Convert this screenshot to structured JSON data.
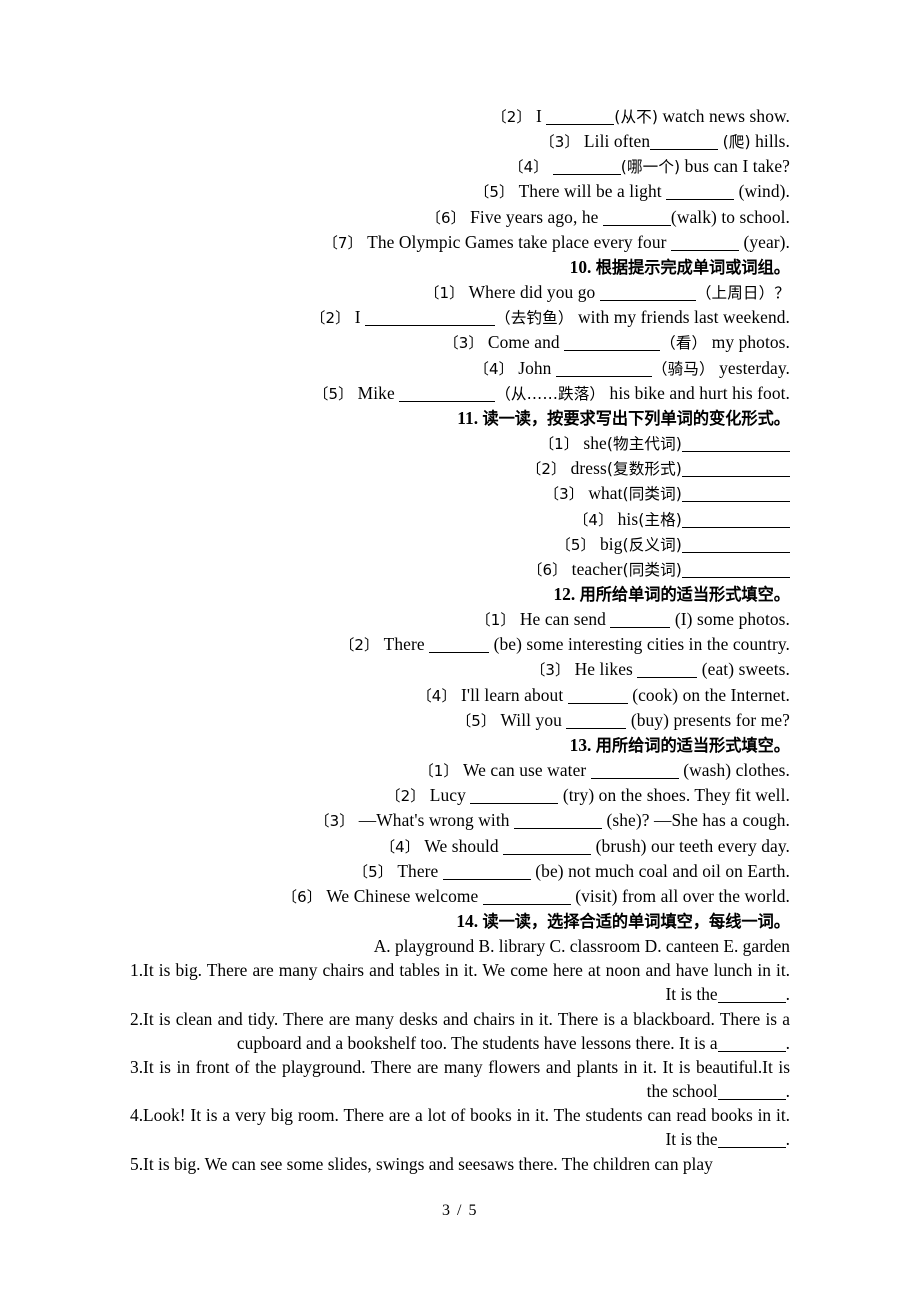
{
  "page": {
    "footer": "3 / 5"
  },
  "section9_tail": {
    "items": [
      {
        "num": "〔2〕",
        "before": "I ",
        "blank": "b7",
        "hint": "(从不)",
        "after": " watch news show."
      },
      {
        "num": "〔3〕",
        "before": "Lili often",
        "blank": "b7",
        "hint": "(爬)",
        "after": " hills."
      },
      {
        "num": "〔4〕",
        "before": "",
        "blank": "b7",
        "hint": "(哪一个)",
        "after": " bus can I take?"
      },
      {
        "num": "〔5〕",
        "before": "There will be a light ",
        "blank": "b7",
        "hint": "(wind)",
        "after": "."
      },
      {
        "num": "〔6〕",
        "before": "Five years ago, he ",
        "blank": "b7",
        "hint": "(walk)",
        "after": " to school."
      },
      {
        "num": "〔7〕",
        "before": "The Olympic Games take place every four ",
        "blank": "b7",
        "hint": "(year)",
        "after": "."
      }
    ]
  },
  "section10": {
    "heading_num": "10.",
    "heading_text": "根据提示完成单词或词组。",
    "items": [
      {
        "num": "〔1〕",
        "before": "Where did you go ",
        "blank": "b10",
        "hint": "（上周日）",
        "after": "？"
      },
      {
        "num": "〔2〕",
        "before": "I ",
        "blank": "b13",
        "hint": "（去钓鱼）",
        "after": " with my friends last weekend."
      },
      {
        "num": "〔3〕",
        "before": "Come and ",
        "blank": "b10",
        "hint": "（看）",
        "after": " my photos."
      },
      {
        "num": "〔4〕",
        "before": "John ",
        "blank": "b10",
        "hint": "（骑马）",
        "after": " yesterday."
      },
      {
        "num": "〔5〕",
        "before": "Mike ",
        "blank": "b10",
        "hint": "（从……跌落）",
        "after": " his bike and hurt his foot."
      }
    ]
  },
  "section11": {
    "heading_num": "11.",
    "heading_text": "读一读，按要求写出下列单词的变化形式。",
    "items": [
      {
        "num": "〔1〕",
        "word": "she",
        "hint": "(物主代词)",
        "blank": "b11"
      },
      {
        "num": "〔2〕",
        "word": "dress",
        "hint": "(复数形式)",
        "blank": "b11"
      },
      {
        "num": "〔3〕",
        "word": "what",
        "hint": "(同类词)",
        "blank": "b11"
      },
      {
        "num": "〔4〕",
        "word": "his",
        "hint": "(主格)",
        "blank": "b11"
      },
      {
        "num": "〔5〕",
        "word": "big",
        "hint": "(反义词)",
        "blank": "b11"
      },
      {
        "num": "〔6〕",
        "word": "teacher",
        "hint": "(同类词)",
        "blank": "b11"
      }
    ]
  },
  "section12": {
    "heading_num": "12.",
    "heading_text": "用所给单词的适当形式填空。",
    "items": [
      {
        "num": "〔1〕",
        "before": "He can send ",
        "blank": "b6",
        "hint": "(I)",
        "after": " some photos."
      },
      {
        "num": "〔2〕",
        "before": "There ",
        "blank": "b6",
        "hint": "(be)",
        "after": " some interesting cities in the country."
      },
      {
        "num": "〔3〕",
        "before": "He likes ",
        "blank": "b6",
        "hint": "(eat)",
        "after": " sweets."
      },
      {
        "num": "〔4〕",
        "before": "I'll learn about ",
        "blank": "b6",
        "hint": "(cook)",
        "after": " on the Internet."
      },
      {
        "num": "〔5〕",
        "before": "Will you ",
        "blank": "b6",
        "hint": "(buy)",
        "after": " presents for me?"
      }
    ]
  },
  "section13": {
    "heading_num": "13.",
    "heading_text": "用所给词的适当形式填空。",
    "items": [
      {
        "num": "〔1〕",
        "before": "We can use water ",
        "blank": "b9",
        "hint": "(wash)",
        "after": " clothes."
      },
      {
        "num": "〔2〕",
        "before": "Lucy ",
        "blank": "b9",
        "hint": "(try)",
        "after": " on the shoes. They fit well."
      },
      {
        "num": "〔3〕",
        "before": "—What's wrong with ",
        "blank": "b9",
        "hint": "(she)?",
        "after": " —She has a cough."
      },
      {
        "num": "〔4〕",
        "before": "We should ",
        "blank": "b9",
        "hint": "(brush)",
        "after": " our teeth every day."
      },
      {
        "num": "〔5〕",
        "before": "There ",
        "blank": "b9",
        "hint": "(be)",
        "after": " not much coal and oil on Earth."
      },
      {
        "num": "〔6〕",
        "before": "We Chinese welcome ",
        "blank": "b9",
        "hint": "(visit)",
        "after": " from all over the world."
      }
    ]
  },
  "section14": {
    "heading_num": "14.",
    "heading_text": "读一读，选择合适的单词填空，每线一词。",
    "options": "A. playground  B. library  C. classroom  D. canteen  E. garden",
    "items": [
      {
        "text": "1.It is big. There are many chairs and tables in it. We come here at noon and have lunch in it. It is the",
        "blank": "b7",
        "tail": "."
      },
      {
        "text": "2.It is clean and tidy. There are many desks and chairs in it. There is a blackboard. There is a cupboard and a bookshelf too. The students have lessons there. It is a",
        "blank": "b7",
        "tail": "."
      },
      {
        "text": "3.It is in front of the playground. There are many flowers and plants in it. It is beautiful.It is the school",
        "blank": "b7",
        "tail": "."
      },
      {
        "text": "4.Look! It is a very big room. There are a lot of books in it. The students can read books in it. It is the",
        "blank": "b7",
        "tail": "."
      },
      {
        "text": "5.It is big. We can see some slides, swings and seesaws there. The children can play",
        "blank": "",
        "tail": ""
      }
    ]
  }
}
